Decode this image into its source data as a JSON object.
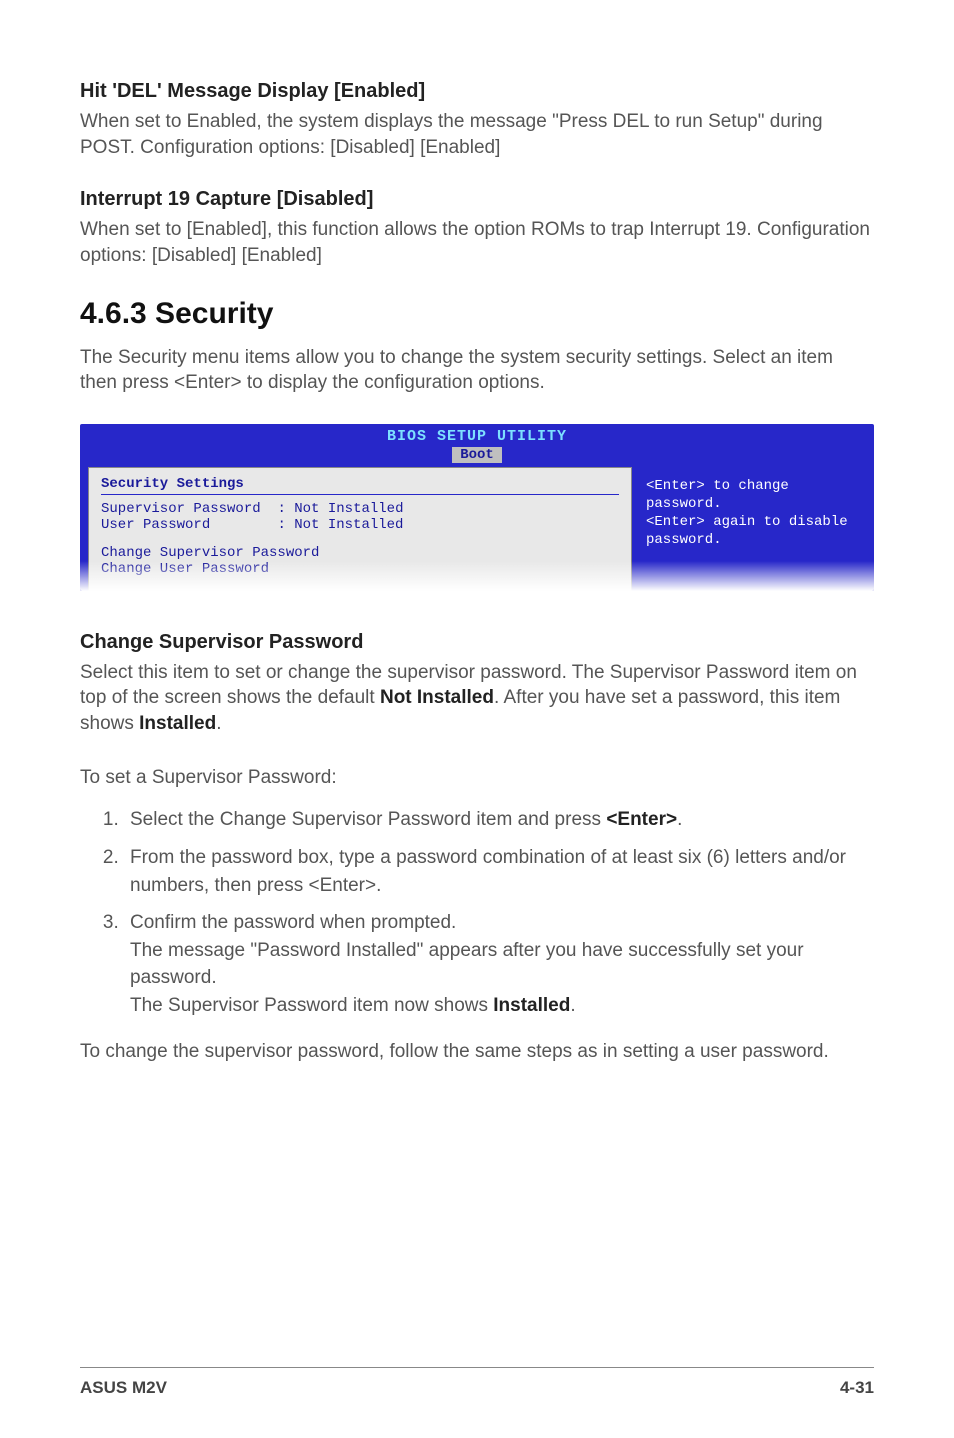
{
  "sec1": {
    "heading": "Hit 'DEL' Message Display [Enabled]",
    "body": "When set to Enabled, the system displays the message \"Press DEL to run Setup\" during POST. Configuration options: [Disabled] [Enabled]"
  },
  "sec2": {
    "heading": "Interrupt 19 Capture [Disabled]",
    "body": "When set to [Enabled], this function allows the option ROMs to trap Interrupt 19. Configuration options: [Disabled] [Enabled]"
  },
  "sec3": {
    "heading": "4.6.3   Security",
    "body": "The Security menu items allow you to change the system security settings. Select an item then press <Enter> to display the configuration options."
  },
  "bios": {
    "title": "BIOS SETUP UTILITY",
    "tab": "Boot",
    "left": {
      "title": "Security Settings",
      "row1_label": "Supervisor Password",
      "row1_value": ": Not Installed",
      "row2_label": "User Password",
      "row2_value": ": Not Installed",
      "row3": "Change Supervisor Password",
      "row4": "Change User Password"
    },
    "help": "<Enter> to change password.\n<Enter> again to disable password."
  },
  "sec4": {
    "heading": "Change Supervisor Password",
    "p1a": "Select this item to set or change the supervisor password. The Supervisor Password item on top of the screen shows the default ",
    "p1b": "Not Installed",
    "p1c": ". After you have set a password, this item shows ",
    "p1d": "Installed",
    "p1e": ".",
    "p2": "To set a Supervisor Password:",
    "li1a": "Select the Change Supervisor Password item and press ",
    "li1b": "<Enter>",
    "li1c": ".",
    "li2": "From the password box, type a password combination of at least six (6) letters and/or numbers, then press <Enter>.",
    "li3a": "Confirm the password when prompted.",
    "li3b": "The message \"Password Installed\" appears after you have successfully set your password.",
    "li3c": "The Supervisor Password item now shows ",
    "li3d": "Installed",
    "li3e": ".",
    "p3": "To change the supervisor password, follow the same steps as in setting a user password."
  },
  "footer": {
    "left": "ASUS M2V",
    "right": "4-31"
  }
}
